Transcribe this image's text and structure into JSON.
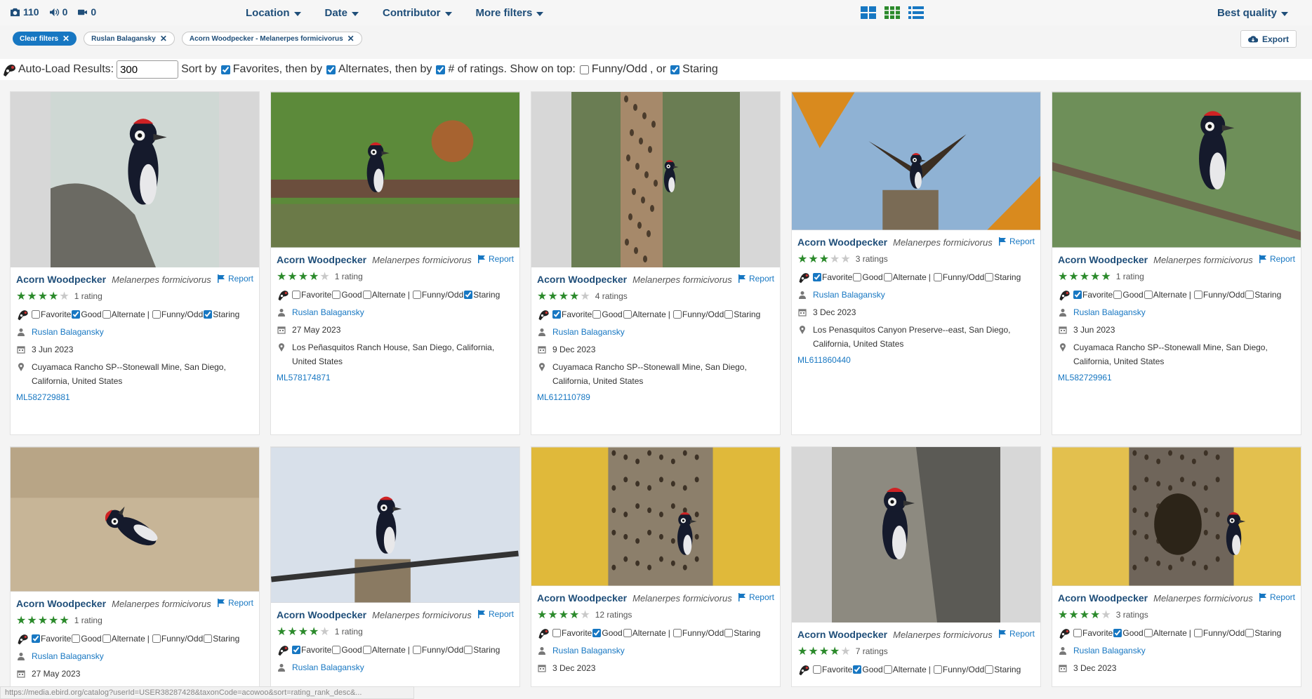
{
  "counts": {
    "photos": "110",
    "audio": "0",
    "video": "0"
  },
  "menus": [
    "Location",
    "Date",
    "Contributor",
    "More filters"
  ],
  "sort_quality": "Best quality",
  "filters": {
    "clear": "Clear filters",
    "contributor": "Ruslan Balagansky",
    "species": "Acorn Woodpecker - Melanerpes formicivorus"
  },
  "export_label": "Export",
  "options": {
    "autoload_label": "Auto-Load Results:",
    "autoload_value": "300",
    "sort_by": "Sort by",
    "favorites": "Favorites, then by",
    "alternates": "Alternates, then by",
    "ratings": "# of ratings. Show on top:",
    "funny": "Funny/Odd",
    "or": ", or",
    "staring": "Staring"
  },
  "labels": {
    "report": "Report",
    "favorite": "Favorite",
    "good": "Good",
    "alternate": "Alternate",
    "pipe": "|",
    "funny": "Funny/Odd",
    "staring": "Staring"
  },
  "cards": [
    {
      "common": "Acorn Woodpecker",
      "sci": "Melanerpes formicivorus",
      "stars": 4,
      "ratings": "1 rating",
      "fav": false,
      "good": true,
      "alt": false,
      "funny": false,
      "staring": true,
      "contributor": "Ruslan Balagansky",
      "date": "3 Jun 2023",
      "location": "Cuyamaca Rancho SP--Stonewall Mine, San Diego, California, United States",
      "asset": "ML582729881"
    },
    {
      "common": "Acorn Woodpecker",
      "sci": "Melanerpes formicivorus",
      "stars": 4,
      "ratings": "1 rating",
      "fav": false,
      "good": false,
      "alt": false,
      "funny": false,
      "staring": true,
      "contributor": "Ruslan Balagansky",
      "date": "27 May 2023",
      "location": "Los Peñasquitos Ranch House, San Diego, California, United States",
      "asset": "ML578174871"
    },
    {
      "common": "Acorn Woodpecker",
      "sci": "Melanerpes formicivorus",
      "stars": 4,
      "ratings": "4 ratings",
      "fav": true,
      "good": false,
      "alt": false,
      "funny": false,
      "staring": false,
      "contributor": "Ruslan Balagansky",
      "date": "9 Dec 2023",
      "location": "Cuyamaca Rancho SP--Stonewall Mine, San Diego, California, United States",
      "asset": "ML612110789"
    },
    {
      "common": "Acorn Woodpecker",
      "sci": "Melanerpes formicivorus",
      "stars": 3,
      "ratings": "3 ratings",
      "fav": true,
      "good": false,
      "alt": false,
      "funny": false,
      "staring": false,
      "contributor": "Ruslan Balagansky",
      "date": "3 Dec 2023",
      "location": "Los Penasquitos Canyon Preserve--east, San Diego, California, United States",
      "asset": "ML611860440"
    },
    {
      "common": "Acorn Woodpecker",
      "sci": "Melanerpes formicivorus",
      "stars": 5,
      "ratings": "1 rating",
      "fav": true,
      "good": false,
      "alt": false,
      "funny": false,
      "staring": false,
      "contributor": "Ruslan Balagansky",
      "date": "3 Jun 2023",
      "location": "Cuyamaca Rancho SP--Stonewall Mine, San Diego, California, United States",
      "asset": "ML582729961"
    },
    {
      "common": "Acorn Woodpecker",
      "sci": "Melanerpes formicivorus",
      "stars": 5,
      "ratings": "1 rating",
      "fav": true,
      "good": false,
      "alt": false,
      "funny": false,
      "staring": false,
      "contributor": "Ruslan Balagansky",
      "date": "27 May 2023"
    },
    {
      "common": "Acorn Woodpecker",
      "sci": "Melanerpes formicivorus",
      "stars": 4,
      "ratings": "1 rating",
      "fav": true,
      "good": false,
      "alt": false,
      "funny": false,
      "staring": false,
      "contributor": "Ruslan Balagansky"
    },
    {
      "common": "Acorn Woodpecker",
      "sci": "Melanerpes formicivorus",
      "stars": 4,
      "ratings": "12 ratings",
      "fav": false,
      "good": true,
      "alt": false,
      "funny": false,
      "staring": false,
      "contributor": "Ruslan Balagansky",
      "date": "3 Dec 2023"
    },
    {
      "common": "Acorn Woodpecker",
      "sci": "Melanerpes formicivorus",
      "stars": 4,
      "ratings": "7 ratings",
      "fav": false,
      "good": true,
      "alt": false,
      "funny": false,
      "staring": false
    },
    {
      "common": "Acorn Woodpecker",
      "sci": "Melanerpes formicivorus",
      "stars": 4,
      "ratings": "3 ratings",
      "fav": false,
      "good": true,
      "alt": false,
      "funny": false,
      "staring": false,
      "contributor": "Ruslan Balagansky",
      "date": "3 Dec 2023"
    }
  ],
  "status_url": "https://media.ebird.org/catalog?userId=USER38287428&taxonCode=acowoo&sort=rating_rank_desc&..."
}
